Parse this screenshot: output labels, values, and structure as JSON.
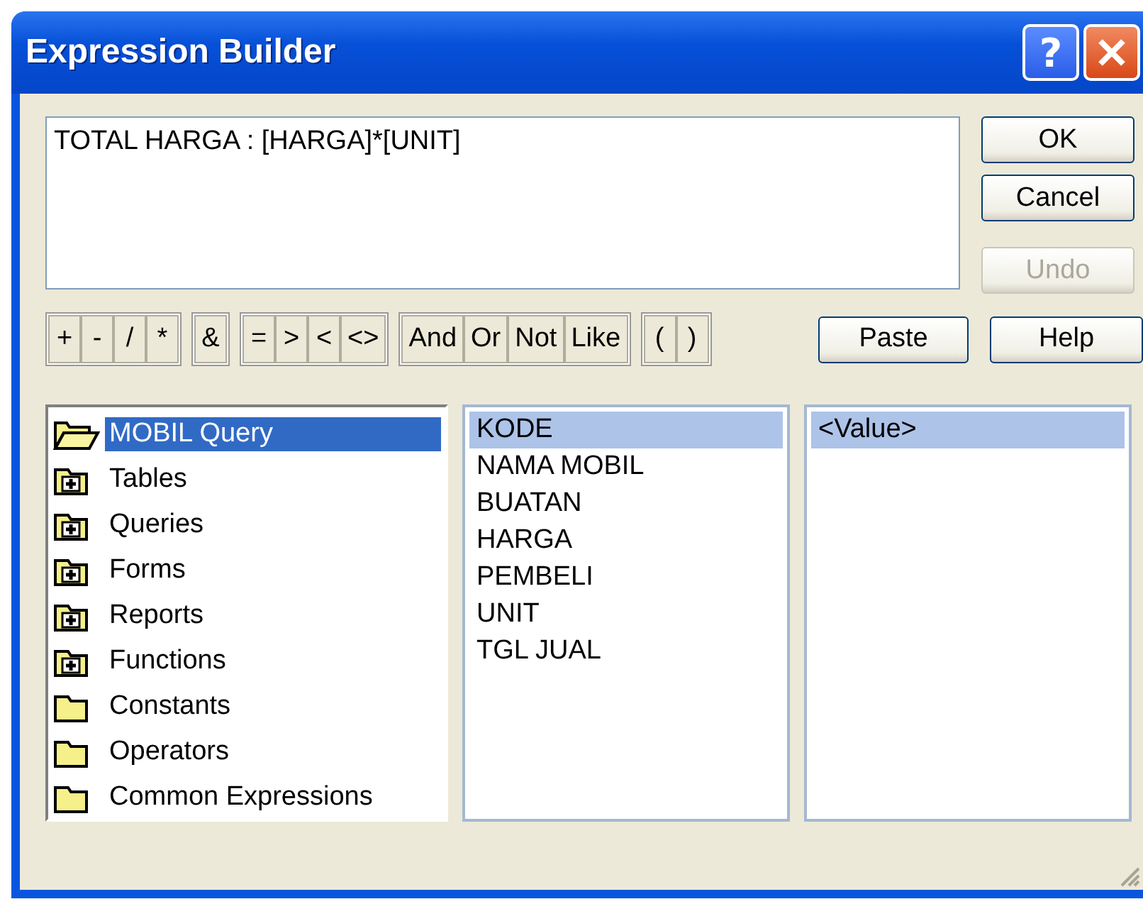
{
  "window": {
    "title": "Expression Builder",
    "help_button": "?"
  },
  "expression": {
    "value": "TOTAL HARGA : [HARGA]*[UNIT]"
  },
  "side_buttons": [
    {
      "label": "OK",
      "disabled": false
    },
    {
      "label": "Cancel",
      "disabled": false
    },
    {
      "label": "Undo",
      "disabled": true
    }
  ],
  "operator_groups": [
    [
      "+",
      "-",
      "/",
      "*"
    ],
    [
      "&"
    ],
    [
      "=",
      ">",
      "<",
      "<>"
    ],
    [
      "And",
      "Or",
      "Not",
      "Like"
    ],
    [
      "(",
      ")"
    ]
  ],
  "paste_button": "Paste",
  "help_button": "Help",
  "tree": [
    {
      "label": "MOBIL Query",
      "kind": "open",
      "selected": true
    },
    {
      "label": "Tables",
      "kind": "plus",
      "selected": false
    },
    {
      "label": "Queries",
      "kind": "plus",
      "selected": false
    },
    {
      "label": "Forms",
      "kind": "plus",
      "selected": false
    },
    {
      "label": "Reports",
      "kind": "plus",
      "selected": false
    },
    {
      "label": "Functions",
      "kind": "plus",
      "selected": false
    },
    {
      "label": "Constants",
      "kind": "closed",
      "selected": false
    },
    {
      "label": "Operators",
      "kind": "closed",
      "selected": false
    },
    {
      "label": "Common Expressions",
      "kind": "closed",
      "selected": false
    }
  ],
  "fields": [
    {
      "label": "KODE",
      "selected": true
    },
    {
      "label": "NAMA MOBIL",
      "selected": false
    },
    {
      "label": "BUATAN",
      "selected": false
    },
    {
      "label": "HARGA",
      "selected": false
    },
    {
      "label": "PEMBELI",
      "selected": false
    },
    {
      "label": "UNIT",
      "selected": false
    },
    {
      "label": "TGL JUAL",
      "selected": false
    }
  ],
  "values": [
    {
      "label": "<Value>",
      "selected": true
    }
  ]
}
